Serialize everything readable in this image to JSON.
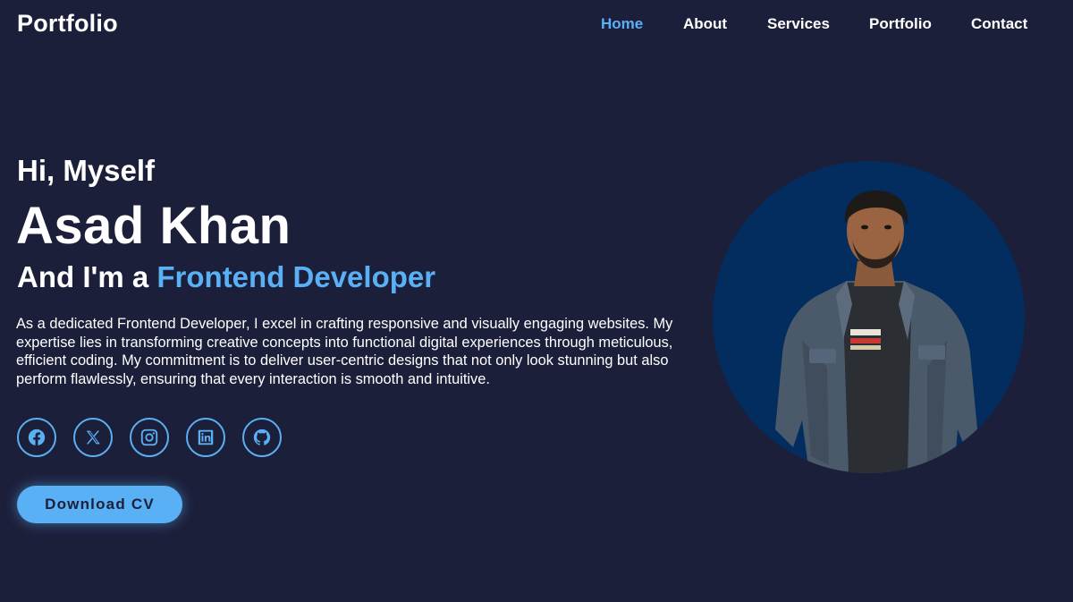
{
  "header": {
    "logo": "Portfolio",
    "nav": [
      {
        "label": "Home",
        "active": true
      },
      {
        "label": "About",
        "active": false
      },
      {
        "label": "Services",
        "active": false
      },
      {
        "label": "Portfolio",
        "active": false
      },
      {
        "label": "Contact",
        "active": false
      }
    ]
  },
  "hero": {
    "greeting": "Hi, Myself",
    "name": "Asad Khan",
    "role_prefix": "And I'm a ",
    "role": "Frontend Developer",
    "description": "As a dedicated Frontend Developer, I excel in crafting responsive and visually engaging websites. My expertise lies in transforming creative concepts into functional digital experiences through meticulous, efficient coding. My commitment is to deliver user-centric designs that not only look stunning but also perform flawlessly, ensuring that every interaction is smooth and intuitive.",
    "socials": [
      "facebook-icon",
      "x-icon",
      "instagram-icon",
      "linkedin-icon",
      "github-icon"
    ],
    "cta_label": "Download CV"
  },
  "colors": {
    "background": "#1c1f3a",
    "accent": "#5ab0f5",
    "portrait_circle": "#022d5e",
    "text": "#ffffff"
  }
}
